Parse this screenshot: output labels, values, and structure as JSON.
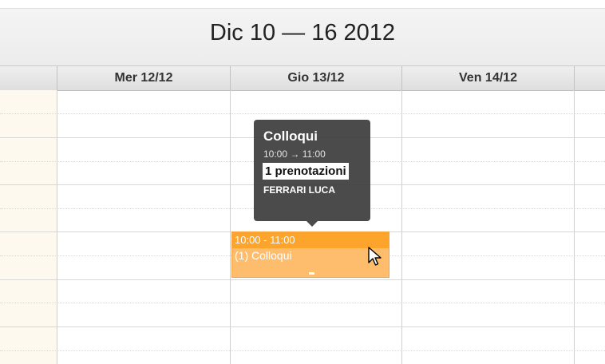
{
  "calendar": {
    "range_title": "Dic 10 — 16 2012",
    "days": [
      {
        "label": "Mer 12/12"
      },
      {
        "label": "Gio 13/12"
      },
      {
        "label": "Ven 14/12"
      }
    ]
  },
  "event": {
    "time": "10:00 - 11:00",
    "title": "(1) Colloqui"
  },
  "tooltip": {
    "title": "Colloqui",
    "time": "10:00 → 11:00",
    "bookings": "1 prenotazioni",
    "person": "FERRARI LUCA"
  },
  "colors": {
    "event_fill": "#fdbd6c",
    "event_header": "#fca42c",
    "tooltip_bg": "#3c3c3c",
    "time_column": "#fdf9ee"
  }
}
